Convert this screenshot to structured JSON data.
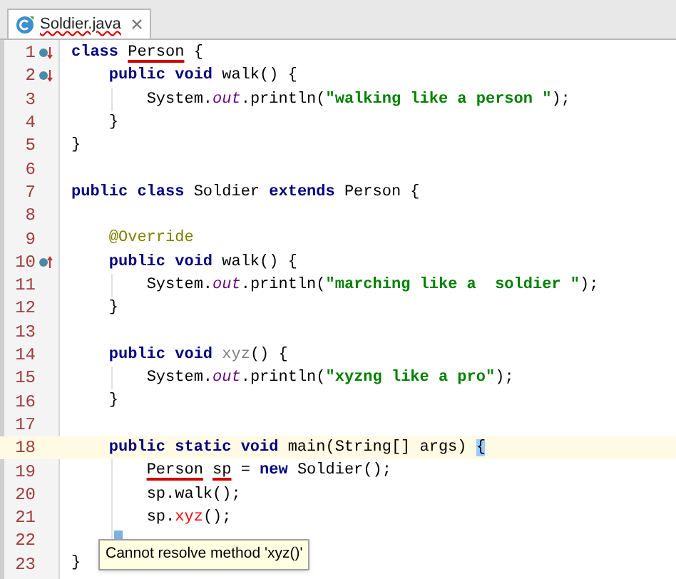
{
  "tab": {
    "title": "Soldier.java",
    "selected": true,
    "misspelled": true
  },
  "lines": [
    {
      "number": "1",
      "overridden": true,
      "tokens": [
        {
          "kind": "keyword",
          "text": "class "
        },
        {
          "kind": "plain",
          "text": "Person",
          "marked": true
        },
        {
          "kind": "plain",
          "text": " {"
        }
      ]
    },
    {
      "number": "2",
      "overridden": true,
      "tokens": [
        {
          "kind": "keyword",
          "text": "    public void "
        },
        {
          "kind": "plain",
          "text": "walk() {"
        }
      ]
    },
    {
      "number": "3",
      "guide": true,
      "tokens": [
        {
          "kind": "plain",
          "text": "        System."
        },
        {
          "kind": "field",
          "text": "out"
        },
        {
          "kind": "plain",
          "text": ".println("
        },
        {
          "kind": "string",
          "text": "\"walking like a person \""
        },
        {
          "kind": "plain",
          "text": ");"
        }
      ]
    },
    {
      "number": "4",
      "tokens": [
        {
          "kind": "plain",
          "text": "    }"
        }
      ]
    },
    {
      "number": "5",
      "tokens": [
        {
          "kind": "plain",
          "text": "}"
        }
      ]
    },
    {
      "number": "6"
    },
    {
      "number": "7",
      "tokens": [
        {
          "kind": "keyword",
          "text": "public class "
        },
        {
          "kind": "plain",
          "text": "Soldier "
        },
        {
          "kind": "keyword",
          "text": "extends "
        },
        {
          "kind": "plain",
          "text": "Person {"
        }
      ]
    },
    {
      "number": "8"
    },
    {
      "number": "9",
      "tokens": [
        {
          "kind": "annotation",
          "text": "    @Override"
        }
      ]
    },
    {
      "number": "10",
      "overrides": true,
      "tokens": [
        {
          "kind": "keyword",
          "text": "    public void "
        },
        {
          "kind": "plain",
          "text": "walk() {"
        }
      ]
    },
    {
      "number": "11",
      "guide": true,
      "tokens": [
        {
          "kind": "plain",
          "text": "        System."
        },
        {
          "kind": "field",
          "text": "out"
        },
        {
          "kind": "plain",
          "text": ".println("
        },
        {
          "kind": "string",
          "text": "\"marching like a  soldier \""
        },
        {
          "kind": "plain",
          "text": ");"
        }
      ]
    },
    {
      "number": "12",
      "tokens": [
        {
          "kind": "plain",
          "text": "    }"
        }
      ]
    },
    {
      "number": "13"
    },
    {
      "number": "14",
      "tokens": [
        {
          "kind": "keyword",
          "text": "    public void "
        },
        {
          "kind": "unused",
          "text": "xyz"
        },
        {
          "kind": "plain",
          "text": "() {"
        }
      ]
    },
    {
      "number": "15",
      "guide": true,
      "tokens": [
        {
          "kind": "plain",
          "text": "        System."
        },
        {
          "kind": "field",
          "text": "out"
        },
        {
          "kind": "plain",
          "text": ".println("
        },
        {
          "kind": "string",
          "text": "\"xyzng like a pro\""
        },
        {
          "kind": "plain",
          "text": ");"
        }
      ]
    },
    {
      "number": "16",
      "tokens": [
        {
          "kind": "plain",
          "text": "    }"
        }
      ]
    },
    {
      "number": "17"
    },
    {
      "number": "18",
      "current": true,
      "tokens": [
        {
          "kind": "keyword",
          "text": "    public static void "
        },
        {
          "kind": "plain",
          "text": "main(String[] args) "
        },
        {
          "kind": "plain",
          "text": "{",
          "matched": true
        }
      ]
    },
    {
      "number": "19",
      "guide": true,
      "tokens": [
        {
          "kind": "plain",
          "text": "        Person",
          "marked": true
        },
        {
          "kind": "plain",
          "text": " sp",
          "marked": true
        },
        {
          "kind": "plain",
          "text": " = "
        },
        {
          "kind": "keyword",
          "text": "new "
        },
        {
          "kind": "plain",
          "text": "Soldier();"
        }
      ]
    },
    {
      "number": "20",
      "guide": true,
      "tokens": [
        {
          "kind": "plain",
          "text": "        sp.walk();"
        }
      ]
    },
    {
      "number": "21",
      "guide": true,
      "tokens": [
        {
          "kind": "plain",
          "text": "        sp."
        },
        {
          "kind": "error",
          "text": "xyz"
        },
        {
          "kind": "plain",
          "text": "();"
        }
      ]
    },
    {
      "number": "22",
      "guide": true,
      "intention": true
    },
    {
      "number": "23",
      "tokens": [
        {
          "kind": "plain",
          "text": "}"
        }
      ]
    }
  ],
  "tooltip": {
    "text": "Cannot resolve method 'xyz()'"
  }
}
